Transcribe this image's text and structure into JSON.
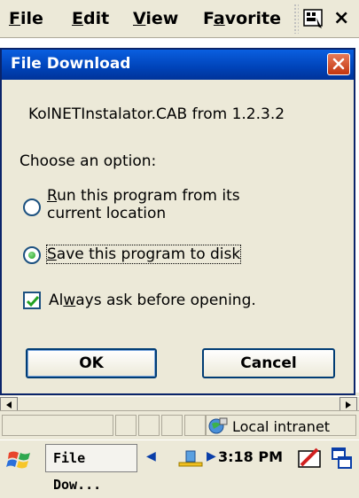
{
  "menubar": {
    "items": [
      {
        "label": "File",
        "underline": "F",
        "rest": "ile"
      },
      {
        "label": "Edit",
        "underline": "E",
        "rest": "dit"
      },
      {
        "label": "View",
        "underline": "V",
        "rest": "iew"
      },
      {
        "label": "Favorite",
        "pre": "F",
        "underline": "a",
        "rest": "vorite"
      }
    ],
    "close_glyph": "×"
  },
  "dialog": {
    "title": "File Download",
    "filename_line": "KolNETInstalator.CAB from 1.2.3.2",
    "prompt": "Choose an option:",
    "options": [
      {
        "underline": "R",
        "line1_rest": "un this program from its",
        "line2": "current location",
        "selected": false
      },
      {
        "underline": "S",
        "rest": "ave this program to disk",
        "selected": true
      }
    ],
    "checkbox": {
      "pre": "Al",
      "underline": "w",
      "rest": "ays ask before opening.",
      "checked": true
    },
    "buttons": {
      "ok": "OK",
      "cancel": "Cancel"
    }
  },
  "statusbar": {
    "zone": "Local intranet"
  },
  "taskbar": {
    "task_label": "File Dow...",
    "clock": "3:18 PM"
  },
  "colors": {
    "title_bar": "#0043b8",
    "radio_selected": "#21a121",
    "check": "#21a121"
  }
}
